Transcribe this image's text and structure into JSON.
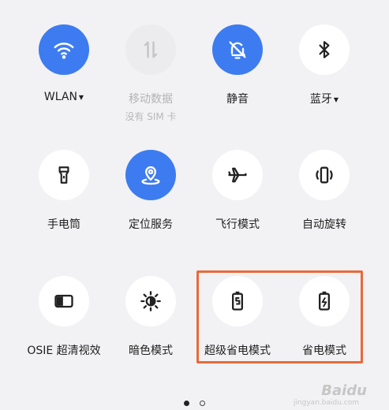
{
  "accent_color": "#3d7cf0",
  "highlight_color": "#e86a3a",
  "tiles": [
    {
      "id": "wlan",
      "label": "WLAN",
      "state": "active",
      "has_caret": true,
      "icon": "wifi-icon"
    },
    {
      "id": "mobile-data",
      "label": "移动数据",
      "sublabel": "没有 SIM 卡",
      "state": "disabled",
      "icon": "arrows-updown-icon"
    },
    {
      "id": "mute",
      "label": "静音",
      "state": "active",
      "icon": "bell-off-icon"
    },
    {
      "id": "bluetooth",
      "label": "蓝牙",
      "state": "inactive",
      "has_caret": true,
      "icon": "bluetooth-icon"
    },
    {
      "id": "flashlight",
      "label": "手电筒",
      "state": "inactive",
      "icon": "flashlight-icon"
    },
    {
      "id": "location",
      "label": "定位服务",
      "state": "active",
      "icon": "location-pin-icon"
    },
    {
      "id": "airplane",
      "label": "飞行模式",
      "state": "inactive",
      "icon": "airplane-icon"
    },
    {
      "id": "auto-rotate",
      "label": "自动旋转",
      "state": "inactive",
      "icon": "rotate-phone-icon"
    },
    {
      "id": "osie",
      "label": "OSIE 超清视效",
      "state": "inactive",
      "icon": "osie-display-icon"
    },
    {
      "id": "dark-mode",
      "label": "暗色模式",
      "state": "inactive",
      "icon": "brightness-icon"
    },
    {
      "id": "super-power-saving",
      "label": "超级省电模式",
      "state": "inactive",
      "icon": "battery-s-icon"
    },
    {
      "id": "power-saving",
      "label": "省电模式",
      "state": "inactive",
      "icon": "battery-bolt-icon"
    }
  ],
  "pager": {
    "pages": 2,
    "current": 1
  },
  "watermark": {
    "text": "Baidu",
    "sub": "jingyan.baidu.com"
  }
}
